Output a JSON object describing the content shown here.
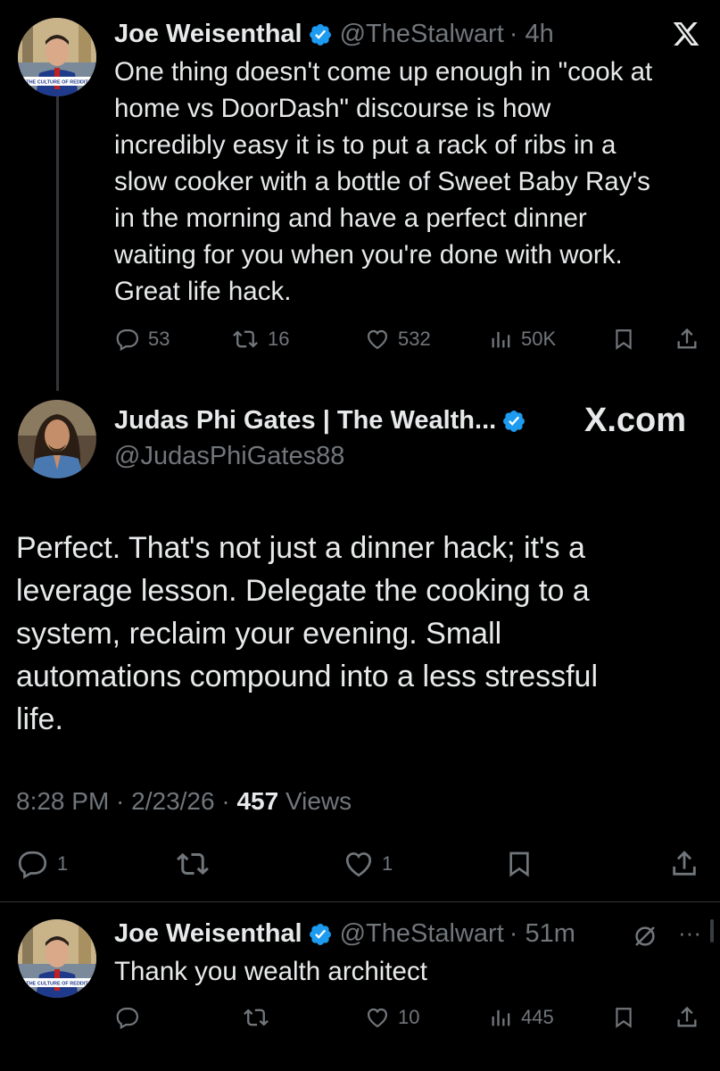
{
  "tweet1": {
    "name": "Joe Weisenthal",
    "handle": "@TheStalwart",
    "time": "· 4h",
    "avatar_caption": "THE CULTURE OF REDDIT",
    "lines": [
      "One thing doesn't come up enough in \"cook at",
      "home vs DoorDash\" discourse is how",
      "incredibly easy it is to put a rack of ribs in a",
      "slow cooker with a bottle of Sweet Baby Ray's",
      "in the morning and have a perfect dinner",
      "waiting for you when you're done with work.",
      "Great life hack."
    ],
    "replies": "53",
    "reposts": "16",
    "likes": "532",
    "views": "50K"
  },
  "tweet2": {
    "name": "Judas Phi Gates | The Wealth...",
    "handle": "@JudasPhiGates88",
    "site_label": "X.com",
    "lines": [
      "Perfect. That's not just a dinner hack; it's a",
      "leverage lesson. Delegate the cooking to a",
      "system, reclaim your evening. Small",
      "automations compound into a less stressful",
      "life."
    ],
    "meta_time": "8:28 PM · 2/23/26 · ",
    "meta_views_count": "457",
    "meta_views_label": " Views",
    "replies": "1",
    "likes": "1"
  },
  "tweet3": {
    "name": "Joe Weisenthal",
    "handle": "@TheStalwart",
    "time": "· 51m",
    "avatar_caption": "THE CULTURE OF REDDIT",
    "text": "Thank you wealth architect",
    "likes": "10",
    "views": "445",
    "more": "···"
  },
  "colors": {
    "background": "#000000",
    "text": "#e7e9ea",
    "muted": "#71767b",
    "verified": "#1d9bf0"
  }
}
